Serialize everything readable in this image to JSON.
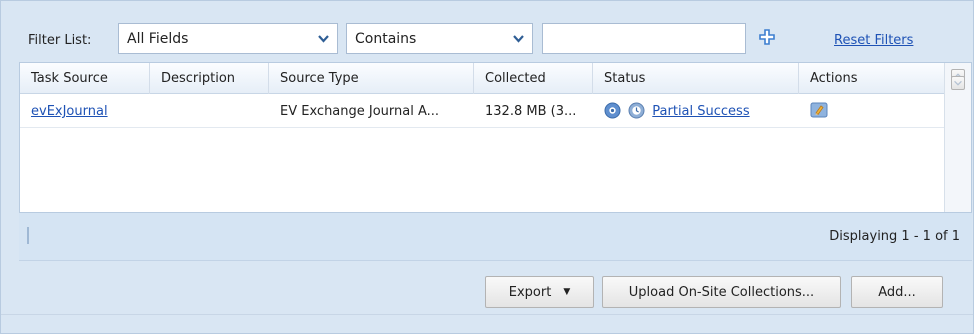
{
  "filter": {
    "label": "Filter List:",
    "field_value": "All Fields",
    "operator_value": "Contains",
    "text_value": "",
    "reset_label": "Reset Filters"
  },
  "grid": {
    "columns": [
      "Task Source",
      "Description",
      "Source Type",
      "Collected",
      "Status",
      "Actions"
    ],
    "rows": [
      {
        "task_source": "evExJournal",
        "description": "",
        "source_type": "EV Exchange Journal A...",
        "collected": "132.8 MB (3...",
        "status": "Partial Success"
      }
    ]
  },
  "pager": {
    "info": "Displaying 1 - 1 of 1"
  },
  "buttons": {
    "export": "Export",
    "upload": "Upload On-Site Collections...",
    "add": "Add..."
  },
  "colors": {
    "background": "#d9e6f3",
    "link": "#1e52b5"
  },
  "icons": {
    "add_filter": "plus-icon",
    "status_1": "info-circle-icon",
    "status_2": "clock-circle-icon",
    "action": "edit-action-icon"
  }
}
